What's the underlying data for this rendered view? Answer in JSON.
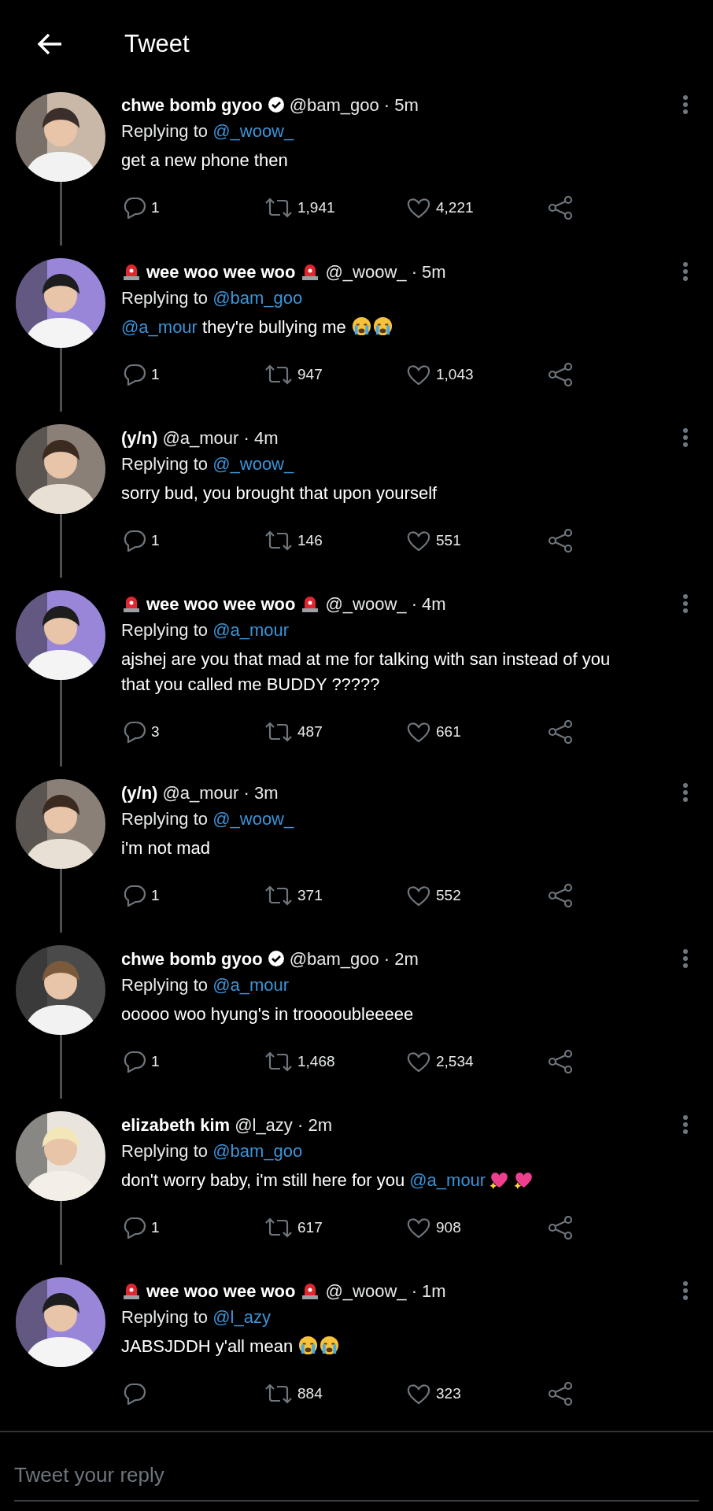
{
  "header": {
    "title": "Tweet"
  },
  "tweets": [
    {
      "name": [
        {
          "kind": "text",
          "text": "chwe bomb gyoo"
        }
      ],
      "verified": true,
      "handle_time": "@bam_goo · 5m",
      "reply_label": "Replying to",
      "replying_to": "@_woow_",
      "text": [
        {
          "kind": "text",
          "text": "get a new phone then"
        }
      ],
      "replies": "1",
      "retweets": "1,941",
      "likes": "4,221"
    },
    {
      "name": [
        {
          "kind": "siren"
        },
        {
          "kind": "text",
          "text": "wee woo wee woo"
        },
        {
          "kind": "siren"
        }
      ],
      "verified": false,
      "handle_time": "@_woow_ · 5m",
      "reply_label": "Replying to",
      "replying_to": "@bam_goo",
      "text": [
        {
          "kind": "mention",
          "text": "@a_mour"
        },
        {
          "kind": "text",
          "text": " they're bullying me "
        },
        {
          "kind": "crying"
        },
        {
          "kind": "crying"
        }
      ],
      "replies": "1",
      "retweets": "947",
      "likes": "1,043"
    },
    {
      "name": [
        {
          "kind": "text",
          "text": "(y/n)"
        }
      ],
      "verified": false,
      "handle_time": "@a_mour · 4m",
      "reply_label": "Replying to",
      "replying_to": "@_woow_",
      "text": [
        {
          "kind": "text",
          "text": "sorry bud, you brought that upon yourself"
        }
      ],
      "replies": "1",
      "retweets": "146",
      "likes": "551"
    },
    {
      "name": [
        {
          "kind": "siren"
        },
        {
          "kind": "text",
          "text": "wee woo wee woo"
        },
        {
          "kind": "siren"
        }
      ],
      "verified": false,
      "handle_time": "@_woow_ · 4m",
      "reply_label": "Replying to",
      "replying_to": "@a_mour",
      "text": [
        {
          "kind": "text",
          "text": "ajshej are you that mad at me for talking with san instead of you that you called me BUDDY ?????"
        }
      ],
      "replies": "3",
      "retweets": "487",
      "likes": "661"
    },
    {
      "name": [
        {
          "kind": "text",
          "text": "(y/n)"
        }
      ],
      "verified": false,
      "handle_time": "@a_mour · 3m",
      "reply_label": "Replying to",
      "replying_to": "@_woow_",
      "text": [
        {
          "kind": "text",
          "text": "i'm not mad"
        }
      ],
      "replies": "1",
      "retweets": "371",
      "likes": "552"
    },
    {
      "name": [
        {
          "kind": "text",
          "text": "chwe bomb gyoo"
        }
      ],
      "verified": true,
      "handle_time": "@bam_goo · 2m",
      "reply_label": "Replying to",
      "replying_to": "@a_mour",
      "text": [
        {
          "kind": "text",
          "text": "ooooo woo hyung's in trooooubleeeee"
        }
      ],
      "replies": "1",
      "retweets": "1,468",
      "likes": "2,534"
    },
    {
      "name": [
        {
          "kind": "text",
          "text": "elizabeth kim"
        }
      ],
      "verified": false,
      "handle_time": "@l_azy · 2m",
      "reply_label": "Replying to",
      "replying_to": "@bam_goo",
      "text": [
        {
          "kind": "text",
          "text": "don't worry baby, i'm still here for you "
        },
        {
          "kind": "mention",
          "text": "@a_mour"
        },
        {
          "kind": "sparkle_heart"
        },
        {
          "kind": "sparkle_heart"
        }
      ],
      "replies": "1",
      "retweets": "617",
      "likes": "908"
    },
    {
      "name": [
        {
          "kind": "siren"
        },
        {
          "kind": "text",
          "text": "wee woo wee woo"
        },
        {
          "kind": "siren"
        }
      ],
      "verified": false,
      "handle_time": "@_woow_ · 1m",
      "reply_label": "Replying to",
      "replying_to": "@l_azy",
      "text": [
        {
          "kind": "text",
          "text": "JABSJDDH y'all mean "
        },
        {
          "kind": "crying"
        },
        {
          "kind": "crying"
        }
      ],
      "retweets": "884",
      "likes": "323"
    }
  ],
  "reply_box": {
    "placeholder": "Tweet your reply"
  }
}
